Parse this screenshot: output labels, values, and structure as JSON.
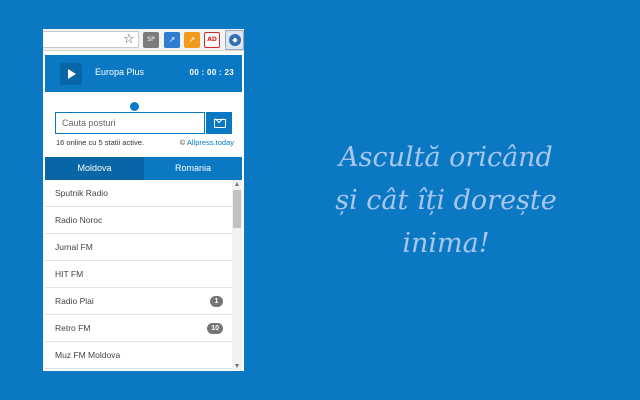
{
  "browser": {
    "star_glyph": "☆",
    "extensions": [
      {
        "name": "ext-1-icon",
        "glyph": "SP"
      },
      {
        "name": "ext-2-icon",
        "glyph": "↗"
      },
      {
        "name": "ext-3-icon",
        "glyph": "↗"
      },
      {
        "name": "ext-4-icon",
        "glyph": "AD"
      },
      {
        "name": "radio-extension-icon",
        "glyph": "◆"
      }
    ]
  },
  "player": {
    "station": "Europa Plus",
    "time": "00 : 00 : 23"
  },
  "search": {
    "placeholder": "Cauta posturi"
  },
  "stats": {
    "online": "16 online cu 5 statii active.",
    "credit_prefix": "© ",
    "credit_link": "Allpress.today"
  },
  "tabs": [
    {
      "label": "Moldova",
      "active": true
    },
    {
      "label": "Romania",
      "active": false
    }
  ],
  "stations": [
    {
      "name": "Sputnik Radio",
      "count": ""
    },
    {
      "name": "Radio Noroc",
      "count": ""
    },
    {
      "name": "Jurnal FM",
      "count": ""
    },
    {
      "name": "HIT FM",
      "count": ""
    },
    {
      "name": "Radio Plai",
      "count": "1"
    },
    {
      "name": "Retro FM",
      "count": "10"
    },
    {
      "name": "Muz FM Moldova",
      "count": ""
    }
  ],
  "slogan": [
    "Ascultă oricând",
    "și cât îți dorește",
    "inima!"
  ],
  "colors": {
    "background": "#0a78c2",
    "accent": "#0a78c2",
    "tab_active": "#0866a6",
    "slogan": "#a9c7ee",
    "badge": "#757575"
  }
}
